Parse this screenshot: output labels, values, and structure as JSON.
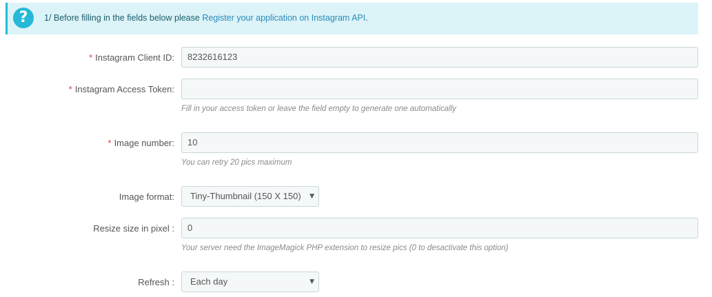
{
  "alert": {
    "icon": "question-circle-icon",
    "text_before": "1/ Before filling in the fields below please ",
    "link_text": "Register your application on Instagram API",
    "text_after": "."
  },
  "fields": {
    "client_id": {
      "required_mark": "*",
      "label": "Instagram Client ID:",
      "value": "8232616123"
    },
    "access_token": {
      "required_mark": "*",
      "label": "Instagram Access Token:",
      "value": "",
      "help": "Fill in your access token or leave the field empty to generate one automatically"
    },
    "image_number": {
      "required_mark": "*",
      "label": "Image number:",
      "value": "10",
      "help": "You can retry 20 pics maximum"
    },
    "image_format": {
      "label": "Image format:",
      "selected": "Tiny-Thumbnail (150 X 150)"
    },
    "resize_size": {
      "label": "Resize size in pixel :",
      "value": "0",
      "help": "Your server need the ImageMagick PHP extension to resize pics (0 to desactivate this option)"
    },
    "refresh": {
      "label": "Refresh :",
      "selected": "Each day"
    }
  },
  "colors": {
    "alert_bg": "#dcf3f8",
    "accent": "#25b9d7",
    "required": "#e0373d"
  }
}
